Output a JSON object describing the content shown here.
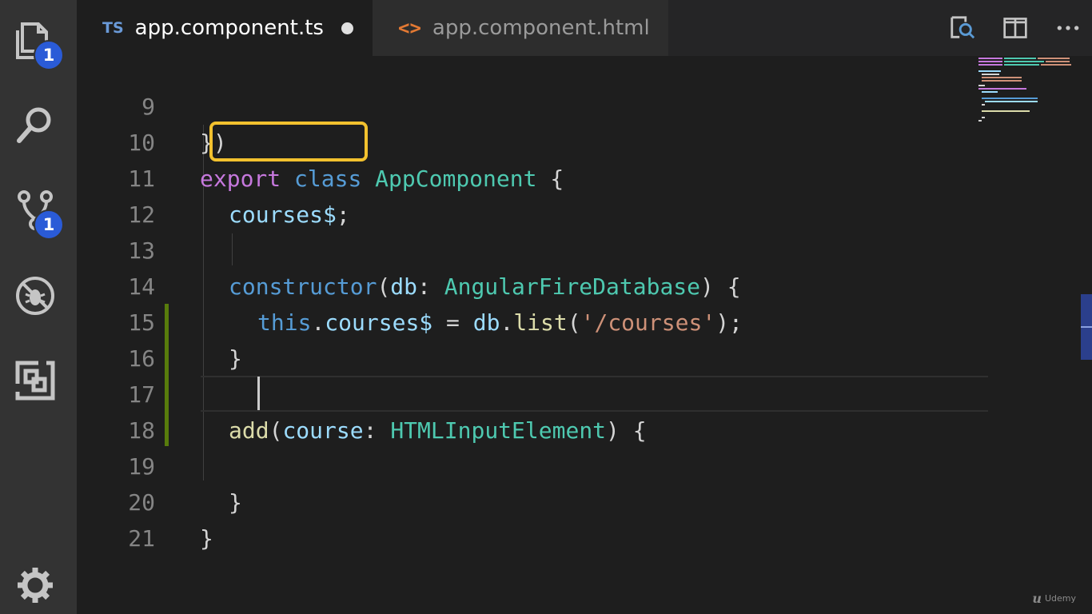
{
  "activity_bar": {
    "explorer_badge": "1",
    "scm_badge": "1"
  },
  "tabs": [
    {
      "lang": "TS",
      "label": "app.component.ts",
      "dirty": true,
      "active": true
    },
    {
      "lang_icon": "<>",
      "label": "app.component.html",
      "dirty": false,
      "active": false
    }
  ],
  "editor": {
    "lines": [
      {
        "num": "9"
      },
      {
        "num": "10"
      },
      {
        "num": "11"
      },
      {
        "num": "12"
      },
      {
        "num": "13"
      },
      {
        "num": "14"
      },
      {
        "num": "15"
      },
      {
        "num": "16"
      },
      {
        "num": "17"
      },
      {
        "num": "18"
      },
      {
        "num": "19"
      },
      {
        "num": "20"
      },
      {
        "num": "21"
      }
    ],
    "code": {
      "l9": {
        "close": "})"
      },
      "l10": {
        "export": "export",
        "class": "class",
        "name": "AppComponent",
        "brace": " {"
      },
      "l11": {
        "prop": "courses$",
        "semi": ";"
      },
      "l13": {
        "ctor": "constructor",
        "paren": "(",
        "param": "db",
        "colon": ": ",
        "type": "AngularFireDatabase",
        "close": ") {"
      },
      "l14": {
        "this": "this",
        "dot1": ".",
        "prop": "courses$",
        "eq": " = ",
        "obj": "db",
        "dot2": ".",
        "method": "list",
        "open": "(",
        "str": "'/courses'",
        "close": ");"
      },
      "l15": {
        "brace": "}"
      },
      "l17": {
        "method": "add",
        "paren": "(",
        "param": "course",
        "colon": ": ",
        "type": "HTMLInputElement",
        "close": ") {"
      },
      "l19": {
        "brace": "}"
      },
      "l20": {
        "brace": "}"
      }
    }
  },
  "watermark": {
    "logo": "u",
    "text": "Udemy"
  },
  "colors": {
    "highlight_box": "#f2c12e",
    "badge": "#2a5bd7",
    "git_added": "#587c0c",
    "scroll_thumb": "#2b3f8c"
  }
}
